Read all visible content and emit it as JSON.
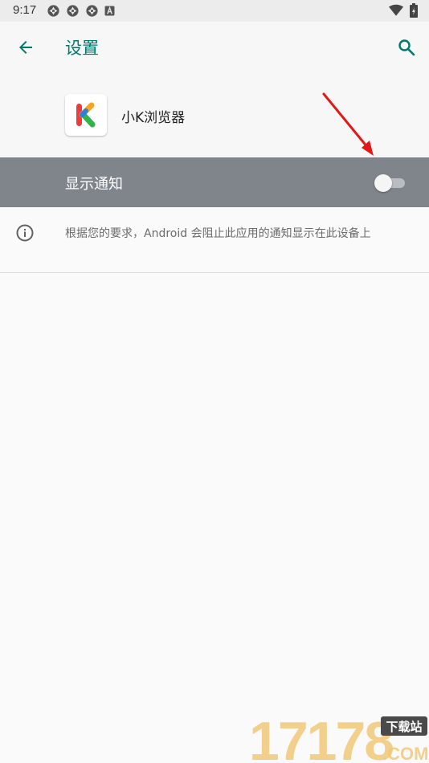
{
  "status_bar": {
    "time": "9:17",
    "left_icons": [
      "aperture-icon",
      "aperture-icon",
      "aperture-icon",
      "a-badge-icon"
    ],
    "right_icons": [
      "wifi-icon",
      "battery-icon"
    ]
  },
  "app_bar": {
    "title": "设置",
    "back_icon": "arrow-back-icon",
    "search_icon": "search-icon",
    "accent_color": "#00796b"
  },
  "app_header": {
    "app_name": "小K浏览器",
    "icon_letter": "K"
  },
  "notification_setting": {
    "label": "显示通知",
    "enabled": false,
    "row_color": "#80858c"
  },
  "info": {
    "icon": "info-icon",
    "text": "根据您的要求，Android 会阻止此应用的通知显示在此设备上"
  },
  "watermark": {
    "main": "17178",
    "badge": "下载站",
    "domain": ".COM"
  }
}
